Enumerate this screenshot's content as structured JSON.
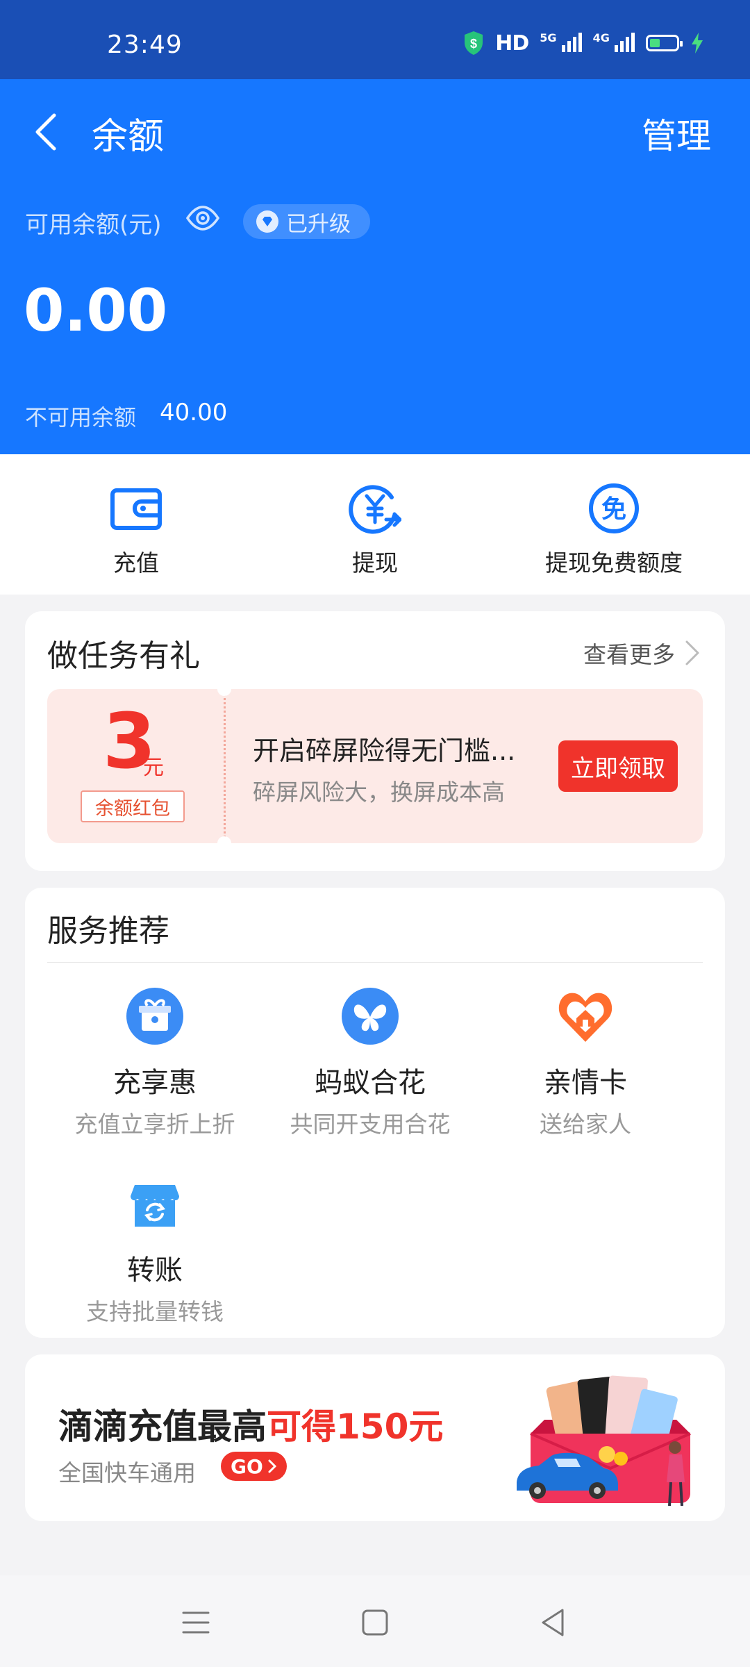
{
  "status_bar": {
    "time": "23:49",
    "hd": "HD",
    "net1": "5G",
    "net2": "4G",
    "icons": [
      "shield-icon",
      "signal-icon",
      "battery-icon",
      "charging-icon"
    ]
  },
  "header": {
    "title": "余额",
    "manage": "管理",
    "balance_label": "可用余额(元)",
    "upgrade_badge": "已升级",
    "balance": "0.00",
    "unavailable_label": "不可用余额",
    "unavailable_value": "40.00"
  },
  "actions": [
    {
      "label": "充值",
      "icon": "wallet-icon"
    },
    {
      "label": "提现",
      "icon": "withdraw-icon"
    },
    {
      "label": "提现免费额度",
      "icon": "free-quota-icon"
    }
  ],
  "tasks": {
    "title": "做任务有礼",
    "see_more": "查看更多",
    "promo": {
      "amount": "3",
      "unit": "元",
      "tag": "余额红包",
      "title": "开启碎屏险得无门槛...",
      "subtitle": "碎屏风险大，换屏成本高",
      "button": "立即领取"
    }
  },
  "services": {
    "title": "服务推荐",
    "items": [
      {
        "name": "充享惠",
        "desc": "充值立享折上折",
        "icon": "gift-icon"
      },
      {
        "name": "蚂蚁合花",
        "desc": "共同开支用合花",
        "icon": "butterfly-icon"
      },
      {
        "name": "亲情卡",
        "desc": "送给家人",
        "icon": "family-card-icon"
      },
      {
        "name": "转账",
        "desc": "支持批量转钱",
        "icon": "transfer-icon"
      }
    ]
  },
  "ad": {
    "title_main": "滴滴充值最高",
    "title_highlight": "可得150元",
    "subtitle": "全国快车通用",
    "go": "GO"
  },
  "colors": {
    "primary_blue": "#1677ff",
    "status_bar_blue": "#1a4fb5",
    "accent_red": "#f0332b",
    "orange": "#ff6d2e"
  }
}
